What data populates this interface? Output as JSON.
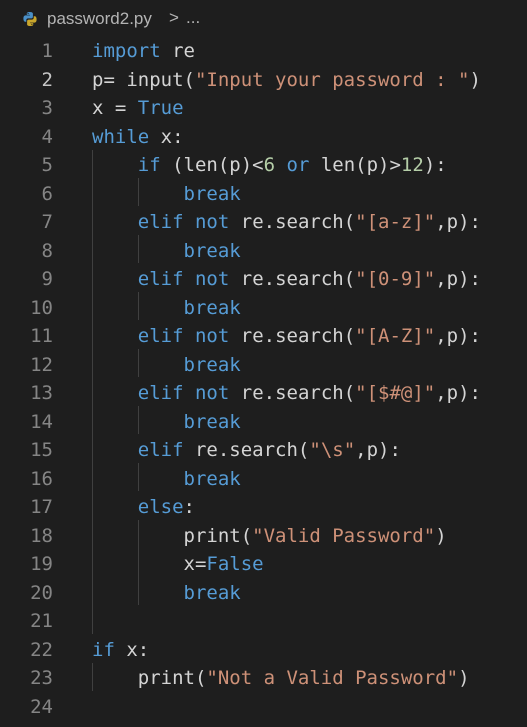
{
  "breadcrumb": {
    "file_name": "password2.py",
    "separator": ">",
    "more": "..."
  },
  "editor": {
    "active_line": 2,
    "lines": [
      {
        "num": "1",
        "tokens": [
          {
            "t": "import",
            "c": "kw-blue"
          },
          {
            "t": " re",
            "c": "plain"
          }
        ]
      },
      {
        "num": "2",
        "tokens": [
          {
            "t": "p= input(",
            "c": "plain"
          },
          {
            "t": "\"Input your password : \"",
            "c": "str"
          },
          {
            "t": ")",
            "c": "plain"
          }
        ]
      },
      {
        "num": "3",
        "tokens": [
          {
            "t": "x = ",
            "c": "plain"
          },
          {
            "t": "True",
            "c": "kw-blue"
          }
        ]
      },
      {
        "num": "4",
        "tokens": [
          {
            "t": "while",
            "c": "kw-blue"
          },
          {
            "t": " x:",
            "c": "plain"
          }
        ]
      },
      {
        "num": "5",
        "tokens": [
          {
            "t": "    ",
            "c": "plain"
          },
          {
            "t": "if",
            "c": "kw-blue"
          },
          {
            "t": " (len(p)<",
            "c": "plain"
          },
          {
            "t": "6",
            "c": "num"
          },
          {
            "t": " ",
            "c": "plain"
          },
          {
            "t": "or",
            "c": "kw-blue"
          },
          {
            "t": " len(p)>",
            "c": "plain"
          },
          {
            "t": "12",
            "c": "num"
          },
          {
            "t": "):",
            "c": "plain"
          }
        ]
      },
      {
        "num": "6",
        "tokens": [
          {
            "t": "        ",
            "c": "plain"
          },
          {
            "t": "break",
            "c": "kw-blue"
          }
        ]
      },
      {
        "num": "7",
        "tokens": [
          {
            "t": "    ",
            "c": "plain"
          },
          {
            "t": "elif",
            "c": "kw-blue"
          },
          {
            "t": " ",
            "c": "plain"
          },
          {
            "t": "not",
            "c": "kw-blue"
          },
          {
            "t": " re.search(",
            "c": "plain"
          },
          {
            "t": "\"[a-z]\"",
            "c": "str"
          },
          {
            "t": ",p):",
            "c": "plain"
          }
        ]
      },
      {
        "num": "8",
        "tokens": [
          {
            "t": "        ",
            "c": "plain"
          },
          {
            "t": "break",
            "c": "kw-blue"
          }
        ]
      },
      {
        "num": "9",
        "tokens": [
          {
            "t": "    ",
            "c": "plain"
          },
          {
            "t": "elif",
            "c": "kw-blue"
          },
          {
            "t": " ",
            "c": "plain"
          },
          {
            "t": "not",
            "c": "kw-blue"
          },
          {
            "t": " re.search(",
            "c": "plain"
          },
          {
            "t": "\"[0-9]\"",
            "c": "str"
          },
          {
            "t": ",p):",
            "c": "plain"
          }
        ]
      },
      {
        "num": "10",
        "tokens": [
          {
            "t": "        ",
            "c": "plain"
          },
          {
            "t": "break",
            "c": "kw-blue"
          }
        ]
      },
      {
        "num": "11",
        "tokens": [
          {
            "t": "    ",
            "c": "plain"
          },
          {
            "t": "elif",
            "c": "kw-blue"
          },
          {
            "t": " ",
            "c": "plain"
          },
          {
            "t": "not",
            "c": "kw-blue"
          },
          {
            "t": " re.search(",
            "c": "plain"
          },
          {
            "t": "\"[A-Z]\"",
            "c": "str"
          },
          {
            "t": ",p):",
            "c": "plain"
          }
        ]
      },
      {
        "num": "12",
        "tokens": [
          {
            "t": "        ",
            "c": "plain"
          },
          {
            "t": "break",
            "c": "kw-blue"
          }
        ]
      },
      {
        "num": "13",
        "tokens": [
          {
            "t": "    ",
            "c": "plain"
          },
          {
            "t": "elif",
            "c": "kw-blue"
          },
          {
            "t": " ",
            "c": "plain"
          },
          {
            "t": "not",
            "c": "kw-blue"
          },
          {
            "t": " re.search(",
            "c": "plain"
          },
          {
            "t": "\"[$#@]\"",
            "c": "str"
          },
          {
            "t": ",p):",
            "c": "plain"
          }
        ]
      },
      {
        "num": "14",
        "tokens": [
          {
            "t": "        ",
            "c": "plain"
          },
          {
            "t": "break",
            "c": "kw-blue"
          }
        ]
      },
      {
        "num": "15",
        "tokens": [
          {
            "t": "    ",
            "c": "plain"
          },
          {
            "t": "elif",
            "c": "kw-blue"
          },
          {
            "t": " re.search(",
            "c": "plain"
          },
          {
            "t": "\"\\s\"",
            "c": "str"
          },
          {
            "t": ",p):",
            "c": "plain"
          }
        ]
      },
      {
        "num": "16",
        "tokens": [
          {
            "t": "        ",
            "c": "plain"
          },
          {
            "t": "break",
            "c": "kw-blue"
          }
        ]
      },
      {
        "num": "17",
        "tokens": [
          {
            "t": "    ",
            "c": "plain"
          },
          {
            "t": "else",
            "c": "kw-blue"
          },
          {
            "t": ":",
            "c": "plain"
          }
        ]
      },
      {
        "num": "18",
        "tokens": [
          {
            "t": "        print(",
            "c": "plain"
          },
          {
            "t": "\"Valid Password\"",
            "c": "str"
          },
          {
            "t": ")",
            "c": "plain"
          }
        ]
      },
      {
        "num": "19",
        "tokens": [
          {
            "t": "        x=",
            "c": "plain"
          },
          {
            "t": "False",
            "c": "kw-blue"
          }
        ]
      },
      {
        "num": "20",
        "tokens": [
          {
            "t": "        ",
            "c": "plain"
          },
          {
            "t": "break",
            "c": "kw-blue"
          }
        ]
      },
      {
        "num": "21",
        "tokens": []
      },
      {
        "num": "22",
        "tokens": [
          {
            "t": "if",
            "c": "kw-blue"
          },
          {
            "t": " x:",
            "c": "plain"
          }
        ]
      },
      {
        "num": "23",
        "tokens": [
          {
            "t": "    print(",
            "c": "plain"
          },
          {
            "t": "\"Not a Valid Password\"",
            "c": "str"
          },
          {
            "t": ")",
            "c": "plain"
          }
        ]
      },
      {
        "num": "24",
        "tokens": []
      }
    ]
  },
  "colors": {
    "background": "#1e1e1e",
    "keyword": "#569cd6",
    "string": "#ce9178",
    "number": "#b5cea8",
    "text": "#d4d4d4",
    "line_number": "#858585"
  }
}
